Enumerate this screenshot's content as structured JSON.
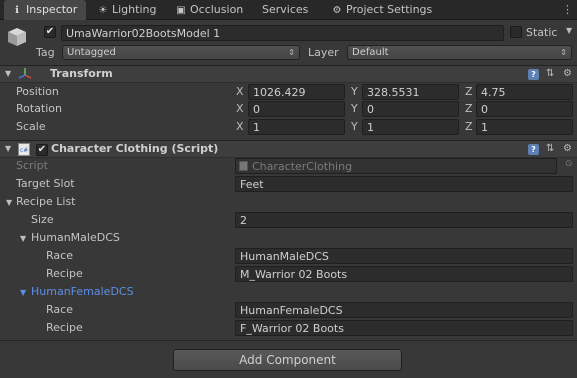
{
  "tabs": [
    {
      "label": "Inspector",
      "icon": "info-icon"
    },
    {
      "label": "Lighting",
      "icon": "lighting-icon"
    },
    {
      "label": "Occlusion",
      "icon": "occlusion-icon"
    },
    {
      "label": "Services",
      "icon": ""
    },
    {
      "label": "Project Settings",
      "icon": "gear-icon"
    }
  ],
  "object": {
    "name": "UmaWarrior02BootsModel 1",
    "static_label": "Static",
    "tag_label": "Tag",
    "tag_value": "Untagged",
    "layer_label": "Layer",
    "layer_value": "Default"
  },
  "transform": {
    "title": "Transform",
    "rows": [
      {
        "label": "Position",
        "x": "1026.429",
        "y": "328.5531",
        "z": "4.75"
      },
      {
        "label": "Rotation",
        "x": "0",
        "y": "0",
        "z": "0"
      },
      {
        "label": "Scale",
        "x": "1",
        "y": "1",
        "z": "1"
      }
    ],
    "axes": [
      "X",
      "Y",
      "Z"
    ]
  },
  "character_clothing": {
    "title": "Character Clothing (Script)",
    "script_label": "Script",
    "script_value": "CharacterClothing",
    "target_slot_label": "Target Slot",
    "target_slot_value": "Feet",
    "recipe_list_label": "Recipe List",
    "size_label": "Size",
    "size_value": "2",
    "groups": [
      {
        "name": "HumanMaleDCS",
        "race_label": "Race",
        "race_value": "HumanMaleDCS",
        "recipe_label": "Recipe",
        "recipe_value": "M_Warrior 02 Boots"
      },
      {
        "name": "HumanFemaleDCS",
        "race_label": "Race",
        "race_value": "HumanFemaleDCS",
        "recipe_label": "Recipe",
        "recipe_value": "F_Warrior 02 Boots"
      }
    ]
  },
  "add_component_label": "Add Component",
  "colors": {
    "background": "#383838",
    "selected_text": "#5b8fe8",
    "help_icon": "#5d7fb3"
  }
}
